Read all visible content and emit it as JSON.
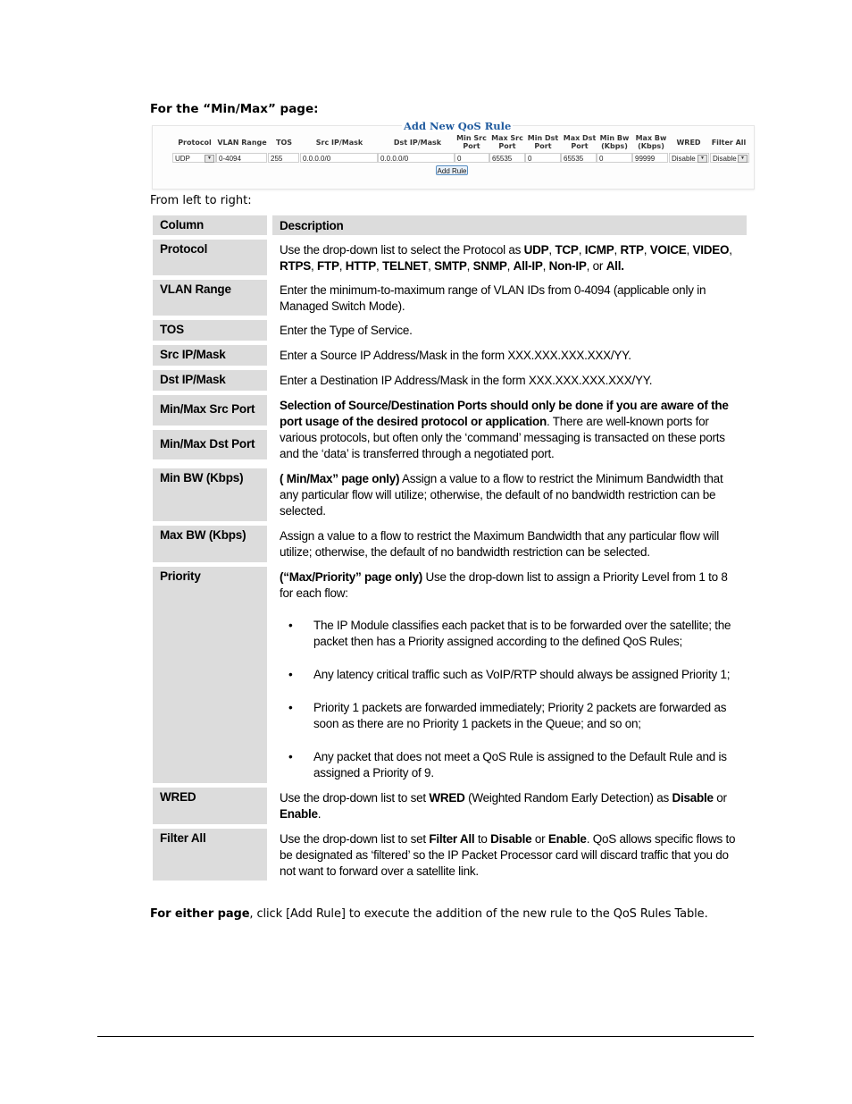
{
  "heading": "For the “Min/Max” page:",
  "qos_panel": {
    "title": "Add New QoS Rule",
    "headers": [
      {
        "key": "protocol",
        "label": "Protocol"
      },
      {
        "key": "vlan",
        "label": "VLAN Range"
      },
      {
        "key": "tos",
        "label": "TOS"
      },
      {
        "key": "src",
        "label": "Src IP/Mask"
      },
      {
        "key": "dst",
        "label": "Dst IP/Mask"
      },
      {
        "key": "minsrc",
        "label": "Min Src Port"
      },
      {
        "key": "maxsrc",
        "label": "Max Src Port"
      },
      {
        "key": "mindst",
        "label": "Min Dst Port"
      },
      {
        "key": "maxdst",
        "label": "Max Dst Port"
      },
      {
        "key": "minbw",
        "label": "Min Bw (Kbps)"
      },
      {
        "key": "maxbw",
        "label": "Max Bw (Kbps)"
      },
      {
        "key": "wred",
        "label": "WRED"
      },
      {
        "key": "filter",
        "label": "Filter All"
      }
    ],
    "values": {
      "protocol": "UDP",
      "vlan": "0-4094",
      "tos": "255",
      "src": "0.0.0.0/0",
      "dst": "0.0.0.0/0",
      "minsrc": "0",
      "maxsrc": "65535",
      "mindst": "0",
      "maxdst": "65535",
      "minbw": "0",
      "maxbw": "99999",
      "wred": "Disable",
      "filter": "Disable"
    },
    "add_button": "Add Rule",
    "dropdown_icon": "chevron-down-icon"
  },
  "intro": "From left to right:",
  "table": {
    "header": {
      "col1": "Column",
      "col2": "Description"
    },
    "rows": {
      "protocol": {
        "name": "Protocol",
        "parts": [
          "Use the drop-down list to select the Protocol as ",
          "UDP",
          ", ",
          "TCP",
          ", ",
          "ICMP",
          ", ",
          "RTP",
          ", ",
          "VOICE",
          ", ",
          "VIDEO",
          ", ",
          "RTPS",
          ", ",
          "FTP",
          ", ",
          "HTTP",
          ", ",
          "TELNET",
          ", ",
          "SMTP",
          ", ",
          "SNMP",
          ", ",
          "All-IP",
          ", ",
          "Non-IP",
          ", or ",
          "All."
        ]
      },
      "vlan": {
        "name": "VLAN Range",
        "desc": "Enter the minimum-to-maximum range of VLAN IDs from 0-4094 (applicable only in Managed Switch Mode)."
      },
      "tos": {
        "name": "TOS",
        "desc": "Enter the Type of Service."
      },
      "src": {
        "name": "Src IP/Mask",
        "desc": "Enter a Source IP Address/Mask in the form XXX.XXX.XXX.XXX/YY."
      },
      "dst": {
        "name": "Dst IP/Mask",
        "desc": "Enter a Destination IP Address/Mask in the form XXX.XXX.XXX.XXX/YY."
      },
      "ports": {
        "name1": "Min/Max Src Port",
        "name2": "Min/Max Dst Port",
        "bold": "Selection of Source/Destination Ports should only be done if you are aware of the port usage of the desired protocol or application",
        "rest": ". There are well-known ports for various protocols, but often only the ‘command’ messaging is transacted on these ports and the ‘data’ is transferred through a negotiated port."
      },
      "minbw": {
        "name": "Min BW (Kbps)",
        "bold": "( Min/Max” page only)",
        "rest": " Assign a value to a flow to restrict the Minimum Bandwidth that any particular flow will utilize; otherwise, the default of no bandwidth restriction can be selected."
      },
      "maxbw": {
        "name": "Max BW (Kbps)",
        "desc": "Assign a value to a flow to restrict the Maximum Bandwidth that any particular flow will utilize; otherwise, the default of no bandwidth restriction can be selected."
      },
      "priority": {
        "name": "Priority",
        "bold": "(“Max/Priority” page only)",
        "rest": " Use the drop-down list to assign a Priority Level from 1 to 8 for each flow:",
        "bullets": [
          "The IP Module classifies each packet that is to be forwarded over the satellite; the packet then has a Priority assigned according to the defined QoS Rules;",
          "Any latency critical traffic such as VoIP/RTP should always be assigned Priority 1;",
          "Priority 1 packets are forwarded immediately; Priority 2 packets are forwarded as soon as there are no Priority 1 packets in the Queue; and so on;",
          "Any packet that does not meet a QoS Rule is assigned to the Default Rule and is assigned a Priority of 9."
        ]
      },
      "wred": {
        "name": "WRED",
        "parts": [
          "Use the drop-down list to set ",
          "WRED",
          " (Weighted Random Early Detection) as ",
          "Disable",
          " or ",
          "Enable",
          "."
        ]
      },
      "filter": {
        "name": "Filter All",
        "parts": [
          "Use the drop-down list to set ",
          "Filter All",
          " to ",
          "Disable",
          " or ",
          "Enable",
          ". QoS allows specific flows to be designated as ‘filtered’ so the IP Packet Processor card will discard traffic that you do not want to forward over a satellite link."
        ]
      }
    }
  },
  "footer": {
    "bold": "For either page",
    "rest": ", click [Add Rule] to execute the addition of the new rule to the QoS Rules Table."
  }
}
